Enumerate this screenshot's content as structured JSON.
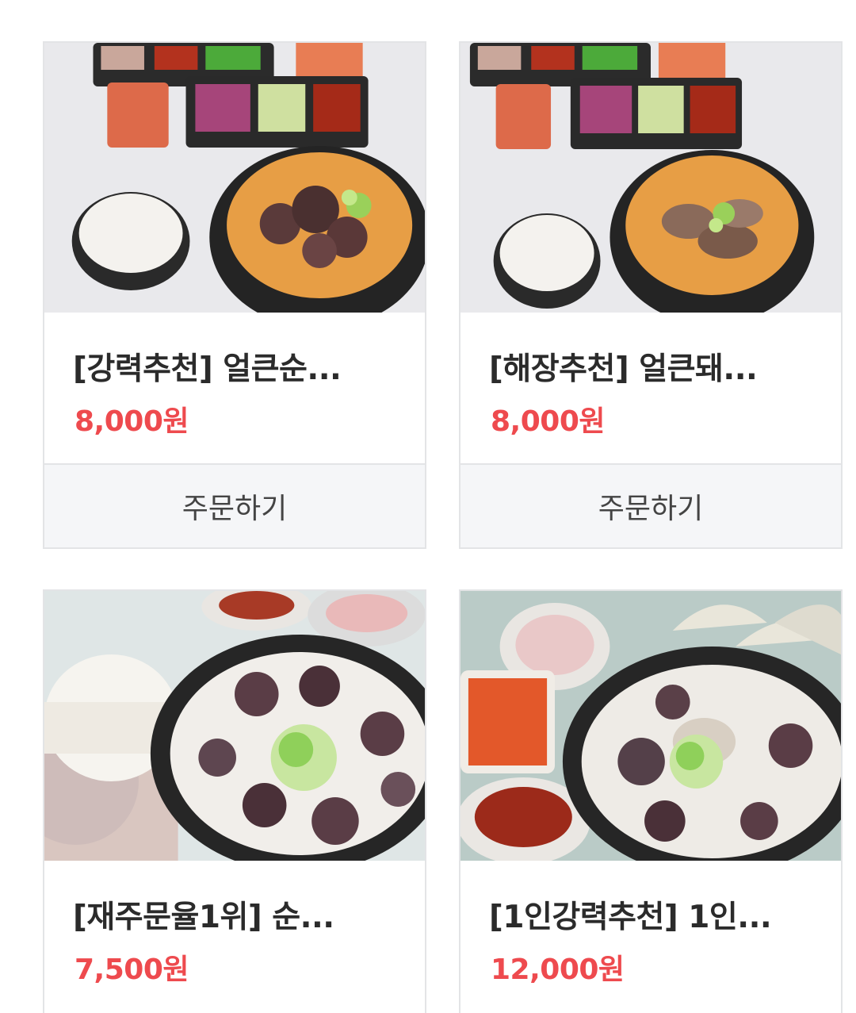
{
  "products": [
    {
      "name": "[강력추천] 얼큰순...",
      "price": "8,000원",
      "order_label": "주문하기"
    },
    {
      "name": "[해장추천] 얼큰돼...",
      "price": "8,000원",
      "order_label": "주문하기"
    },
    {
      "name": "[재주문율1위] 순...",
      "price": "7,500원"
    },
    {
      "name": "[1인강력추천] 1인...",
      "price": "12,000원"
    }
  ],
  "colors": {
    "price": "#ee4a4e",
    "border": "#e3e4e6",
    "button_bg": "#f5f6f8"
  }
}
